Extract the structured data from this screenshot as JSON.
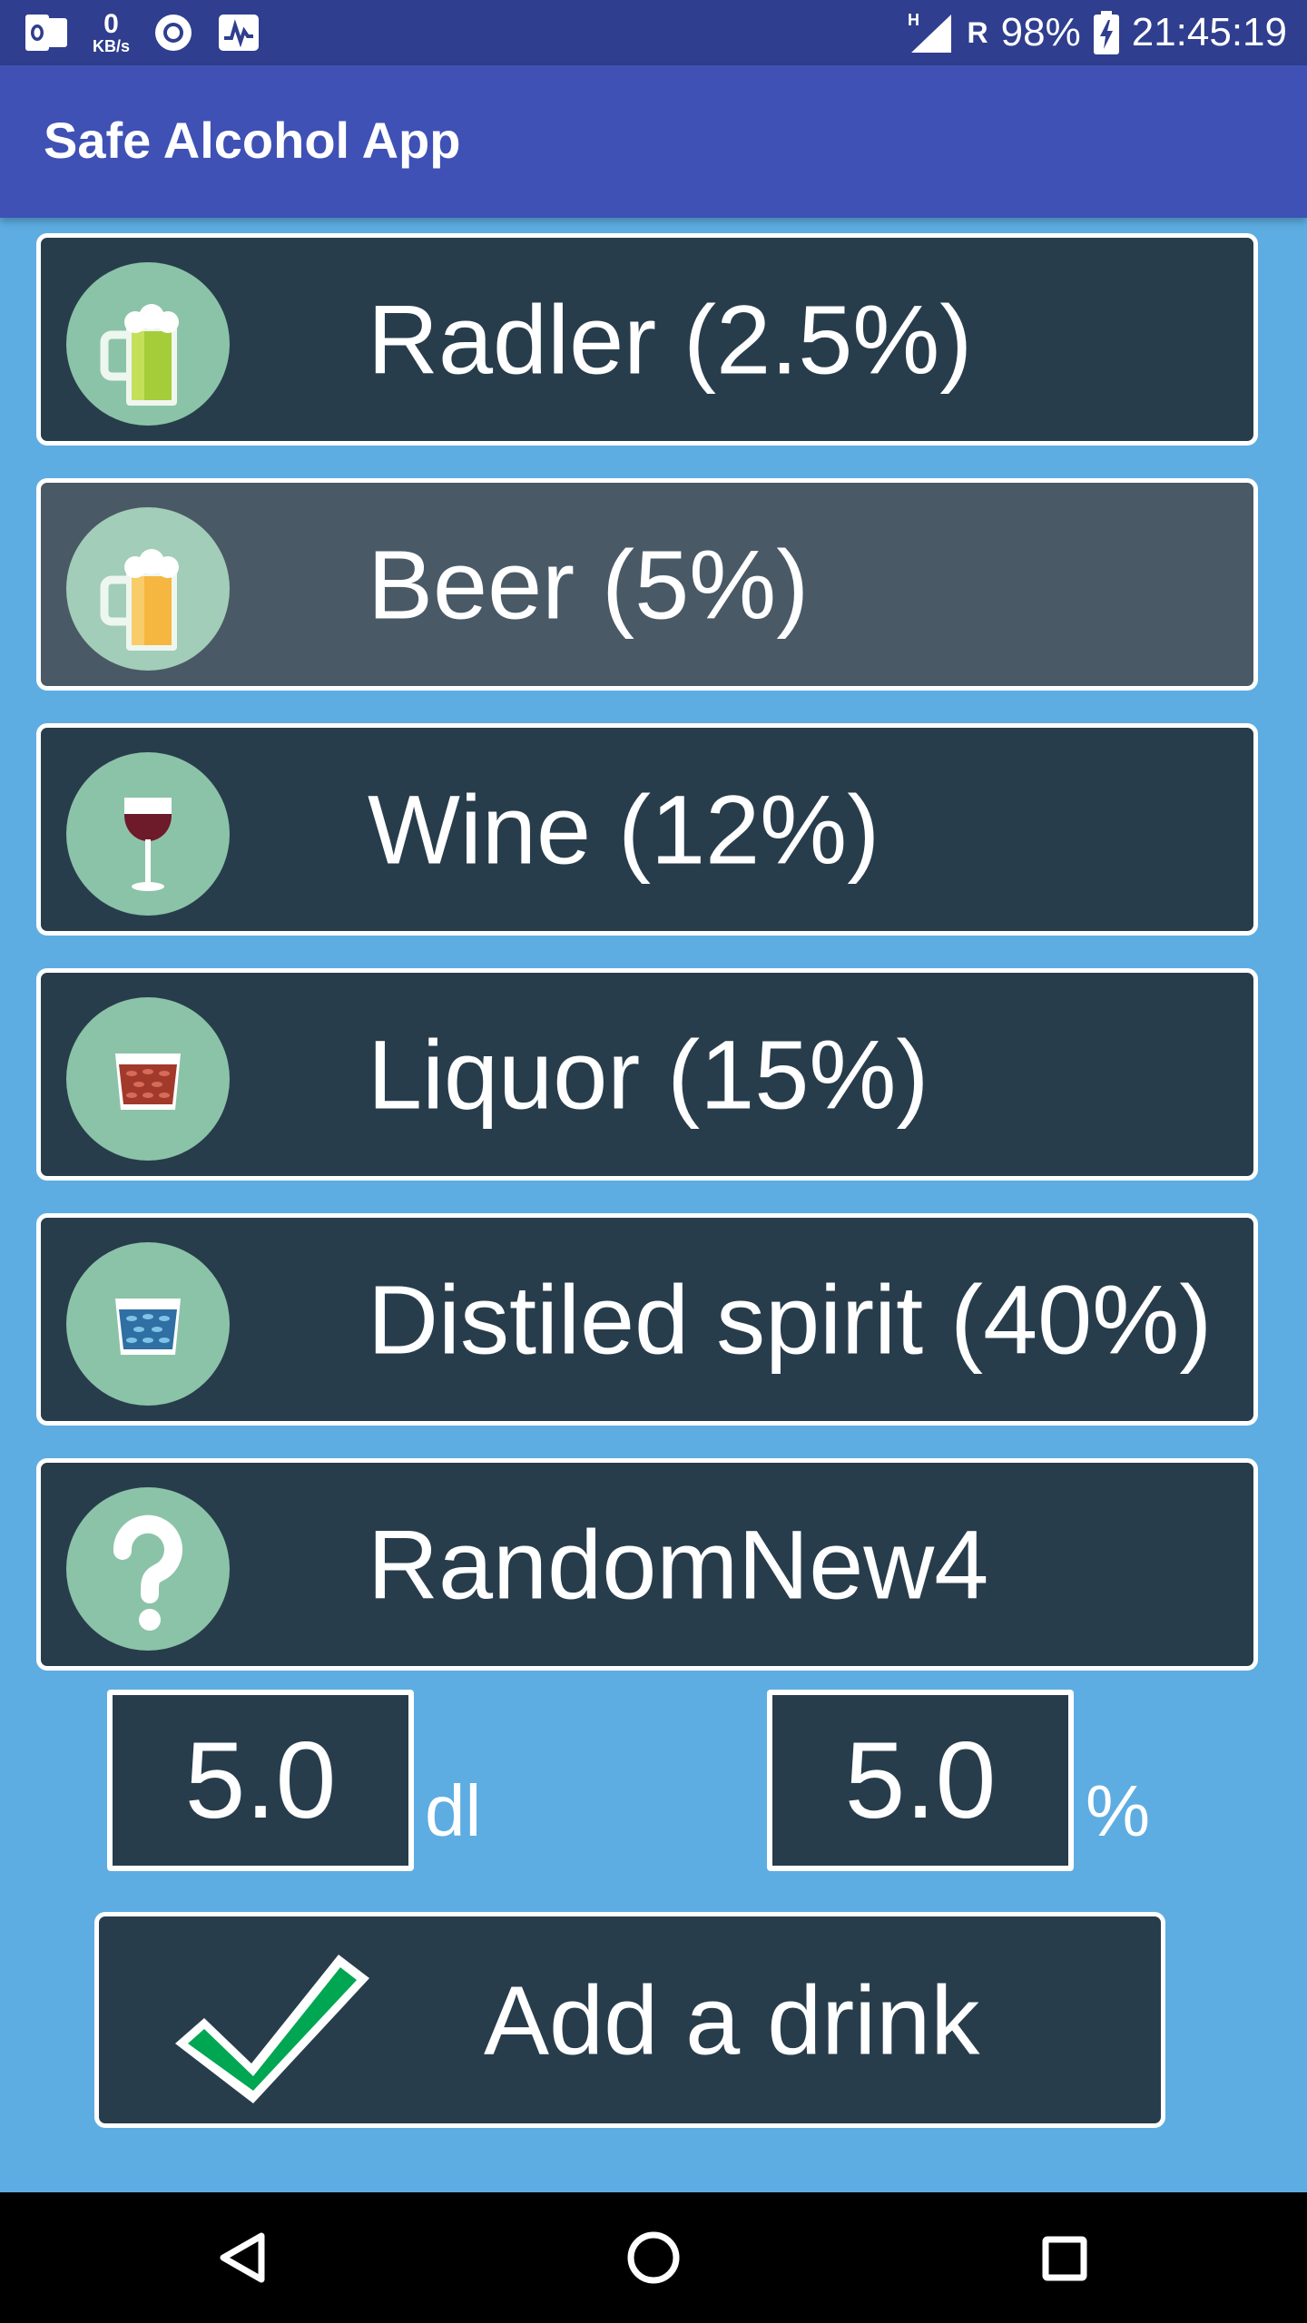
{
  "status_bar": {
    "speed_value": "0",
    "speed_unit": "KB/s",
    "network_type": "H",
    "roaming": "R",
    "battery": "98%",
    "time": "21:45:19",
    "icons": [
      "outlook-icon",
      "circle-app-icon",
      "activity-chart-icon",
      "signal-icon",
      "battery-charging-icon"
    ]
  },
  "app_bar": {
    "title": "Safe Alcohol App"
  },
  "drinks": [
    {
      "label": "Radler (2.5%)",
      "icon": "radler-mug-icon",
      "selected": false
    },
    {
      "label": "Beer (5%)",
      "icon": "beer-mug-icon",
      "selected": true
    },
    {
      "label": "Wine (12%)",
      "icon": "wine-glass-icon",
      "selected": false
    },
    {
      "label": "Liquor (15%)",
      "icon": "liquor-glass-icon",
      "selected": false
    },
    {
      "label": "Distiled spirit (40%)",
      "icon": "spirit-glass-icon",
      "selected": false
    },
    {
      "label": "RandomNew4",
      "icon": "question-mark-icon",
      "selected": false
    }
  ],
  "amount": {
    "value": "5.0",
    "unit": "dl"
  },
  "percent": {
    "value": "5.0",
    "unit": "%"
  },
  "add_button": {
    "label": "Add a drink",
    "icon": "checkmark-icon",
    "icon_color": "#00a651"
  },
  "colors": {
    "background": "#5dade2",
    "app_bar": "#3f51b5",
    "status_bar": "#2f3e8e",
    "row": "#283d4c",
    "row_selected": "#4a5966",
    "icon_circle": "#8bc3a8"
  },
  "nav_bar": {
    "buttons": [
      "back-icon",
      "home-icon",
      "recents-icon"
    ]
  }
}
